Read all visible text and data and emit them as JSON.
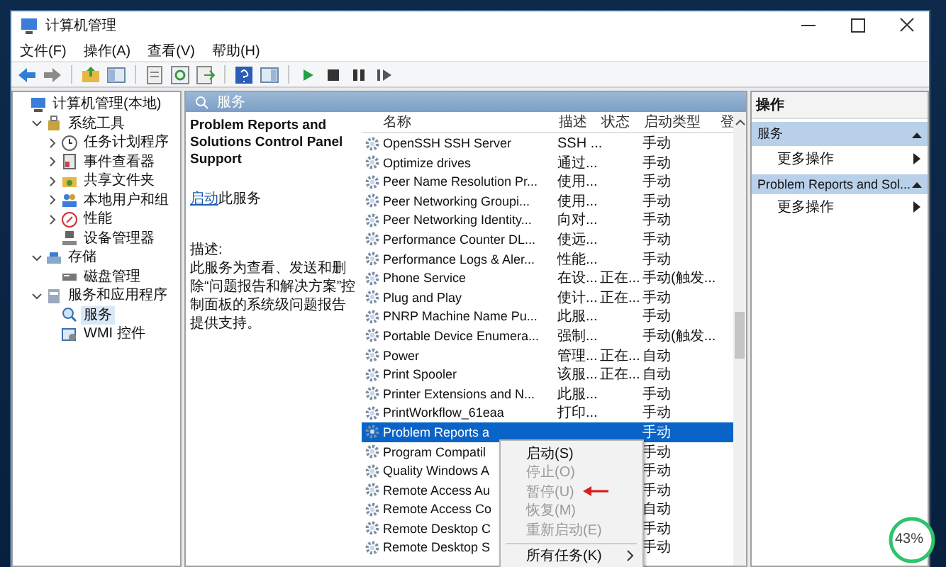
{
  "window": {
    "title": "计算机管理"
  },
  "menu": [
    "文件(F)",
    "操作(A)",
    "查看(V)",
    "帮助(H)"
  ],
  "tree": [
    {
      "label": "计算机管理(本地)",
      "selected": false,
      "children": [
        {
          "label": "系统工具",
          "expanded": true,
          "selected": false,
          "children": [
            {
              "label": "任务计划程序",
              "expanded": false,
              "selected": false
            },
            {
              "label": "事件查看器",
              "expanded": false,
              "selected": false
            },
            {
              "label": "共享文件夹",
              "expanded": false,
              "selected": false
            },
            {
              "label": "本地用户和组",
              "expanded": false,
              "selected": false
            },
            {
              "label": "性能",
              "expanded": false,
              "selected": false
            },
            {
              "label": "设备管理器",
              "selected": false
            }
          ]
        },
        {
          "label": "存储",
          "expanded": true,
          "selected": false,
          "children": [
            {
              "label": "磁盘管理",
              "selected": false
            }
          ]
        },
        {
          "label": "服务和应用程序",
          "expanded": true,
          "selected": false,
          "children": [
            {
              "label": "服务",
              "selected": true
            },
            {
              "label": "WMI 控件",
              "selected": false
            }
          ]
        }
      ]
    }
  ],
  "pane_header": {
    "title": "服务"
  },
  "details": {
    "title": "Problem Reports and Solutions Control Panel Support",
    "action_link": "启动",
    "action_text": "此服务",
    "description_label": "描述:",
    "description": "此服务为查看、发送和删除“问题报告和解决方案”控制面板的系统级问题报告提供支持。"
  },
  "table": {
    "columns": [
      "名称",
      "描述",
      "状态",
      "启动类型",
      "登"
    ],
    "rows": [
      {
        "name": "OpenSSH SSH Server",
        "description": "SSH ...",
        "startup_type": "手动",
        "selected": false
      },
      {
        "name": "Optimize drives",
        "description": "通过...",
        "startup_type": "手动",
        "selected": false
      },
      {
        "name": "Peer Name Resolution Pr...",
        "description": "使用...",
        "startup_type": "手动",
        "selected": false
      },
      {
        "name": "Peer Networking Groupi...",
        "description": "使用...",
        "startup_type": "手动",
        "selected": false
      },
      {
        "name": "Peer Networking Identity...",
        "description": "向对...",
        "startup_type": "手动",
        "selected": false
      },
      {
        "name": "Performance Counter DL...",
        "description": "使远...",
        "startup_type": "手动",
        "selected": false
      },
      {
        "name": "Performance Logs & Aler...",
        "description": "性能...",
        "startup_type": "手动",
        "selected": false
      },
      {
        "name": "Phone Service",
        "description": "在设...",
        "status": "正在...",
        "startup_type": "手动(触发...",
        "selected": false
      },
      {
        "name": "Plug and Play",
        "description": "使计...",
        "status": "正在...",
        "startup_type": "手动",
        "selected": false
      },
      {
        "name": "PNRP Machine Name Pu...",
        "description": "此服...",
        "startup_type": "手动",
        "selected": false
      },
      {
        "name": "Portable Device Enumera...",
        "description": "强制...",
        "startup_type": "手动(触发...",
        "selected": false
      },
      {
        "name": "Power",
        "description": "管理...",
        "status": "正在...",
        "startup_type": "自动",
        "selected": false
      },
      {
        "name": "Print Spooler",
        "description": "该服...",
        "status": "正在...",
        "startup_type": "自动",
        "selected": false
      },
      {
        "name": "Printer Extensions and N...",
        "description": "此服...",
        "startup_type": "手动",
        "selected": false
      },
      {
        "name": "PrintWorkflow_61eaa",
        "description": "打印...",
        "startup_type": "手动",
        "selected": false
      },
      {
        "name": "Problem Reports a",
        "startup_type": "手动",
        "selected": true
      },
      {
        "name": "Program Compatil",
        "startup_type": "手动",
        "selected": false
      },
      {
        "name": "Quality Windows A",
        "startup_type": "手动",
        "selected": false
      },
      {
        "name": "Remote Access Au",
        "startup_type": "手动",
        "selected": false
      },
      {
        "name": "Remote Access Co",
        "startup_type": "自动",
        "selected": false
      },
      {
        "name": "Remote Desktop C",
        "startup_type": "手动",
        "selected": false
      },
      {
        "name": "Remote Desktop S",
        "startup_type": "手动",
        "selected": false
      }
    ]
  },
  "context_menu": [
    {
      "kind": "item",
      "label": "启动(S)",
      "disabled": false,
      "annotated": false
    },
    {
      "kind": "item",
      "label": "停止(O)",
      "disabled": true,
      "annotated": false
    },
    {
      "kind": "item",
      "label": "暂停(U)",
      "disabled": true,
      "annotated": true
    },
    {
      "kind": "item",
      "label": "恢复(M)",
      "disabled": true,
      "annotated": false
    },
    {
      "kind": "item",
      "label": "重新启动(E)",
      "disabled": true,
      "annotated": false
    },
    {
      "kind": "separator"
    },
    {
      "kind": "submenu",
      "label": "所有任务(K)",
      "disabled": false,
      "annotated": false
    }
  ],
  "actions": {
    "title": "操作",
    "sections": [
      {
        "title": "服务",
        "items": [
          "更多操作"
        ]
      },
      {
        "title": "Problem Reports and Sol...",
        "items": [
          "更多操作"
        ]
      }
    ]
  },
  "progress_badge": {
    "text": "43%"
  }
}
